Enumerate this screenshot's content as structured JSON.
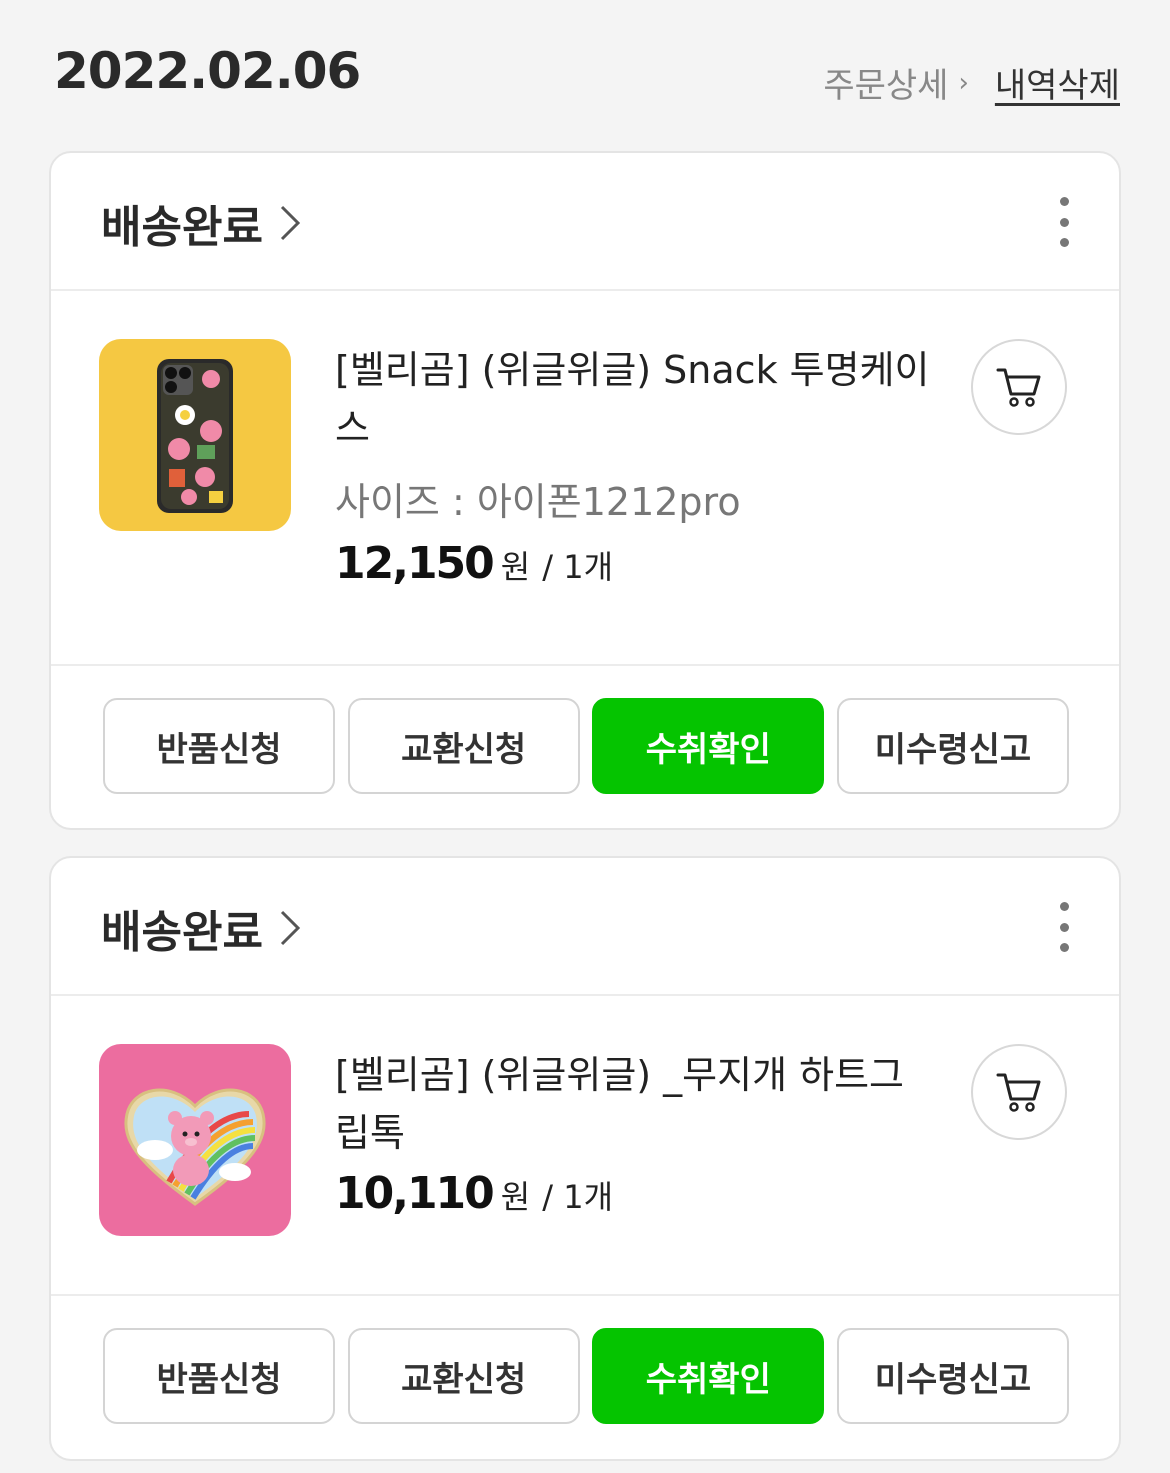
{
  "header": {
    "date": "2022.02.06",
    "detail_label": "주문상세",
    "delete_label": "내역삭제"
  },
  "orders": [
    {
      "status": "배송완료",
      "product_name": "[벨리곰] (위글위글) Snack 투명케이스",
      "option": "사이즈 : 아이폰1212pro",
      "price": "12,150",
      "currency": "원",
      "quantity": "/ 1개",
      "buttons": [
        "반품신청",
        "교환신청",
        "수취확인",
        "미수령신고"
      ]
    },
    {
      "status": "배송완료",
      "product_name": "[벨리곰] (위글위글) _무지개 하트그립톡",
      "price": "10,110",
      "currency": "원",
      "quantity": "/ 1개",
      "buttons": [
        "반품신청",
        "교환신청",
        "수취확인",
        "미수령신고"
      ]
    }
  ],
  "colors": {
    "primary_button": "#05c400",
    "thumb1_bg": "#f5c842",
    "thumb2_bg": "#ec6d9f",
    "page_bg": "#f4f4f4"
  }
}
